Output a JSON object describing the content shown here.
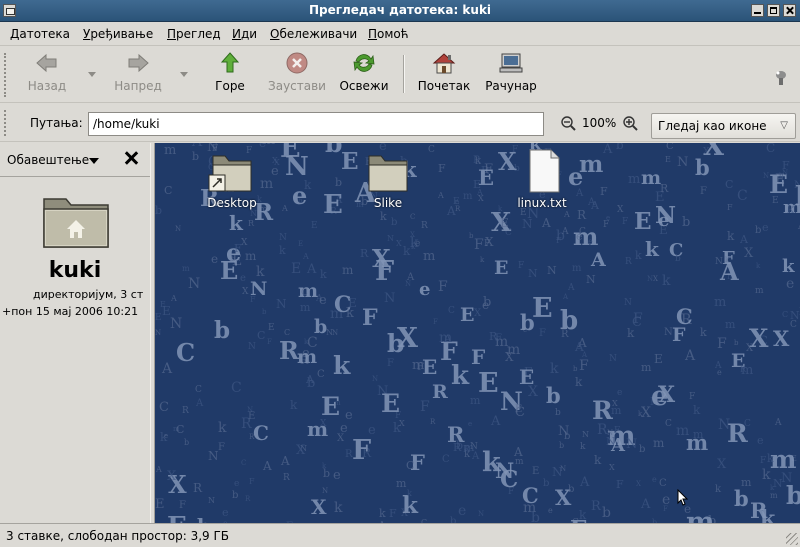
{
  "window": {
    "title": "Прегледач датотека: kuki"
  },
  "menubar": {
    "items": [
      "Датотека",
      "Уређивање",
      "Преглед",
      "Иди",
      "Обележивачи",
      "Помоћ"
    ]
  },
  "toolbar": {
    "back": "Назад",
    "forward": "Напред",
    "up": "Горе",
    "stop": "Заустави",
    "reload": "Освежи",
    "home": "Почетак",
    "computer": "Рачунар"
  },
  "location": {
    "label": "Путања:",
    "path": "/home/kuki",
    "zoom": "100%",
    "view_mode": "Гледај као иконе"
  },
  "sidebar": {
    "panel": "Обавештење",
    "folder_name": "kuki",
    "info_line1": "директоријум, 3 ст",
    "info_line2": "+пон 15 мај 2006 10:21"
  },
  "files": [
    {
      "name": "Desktop",
      "kind": "folder-link"
    },
    {
      "name": "Slike",
      "kind": "folder"
    },
    {
      "name": "linux.txt",
      "kind": "text-file"
    }
  ],
  "status": {
    "text": "3 ставке, слободан простор: 3,9 ГБ"
  },
  "colors": {
    "titlebar": "#2f5a82",
    "desktop_bg": "#203a68"
  }
}
